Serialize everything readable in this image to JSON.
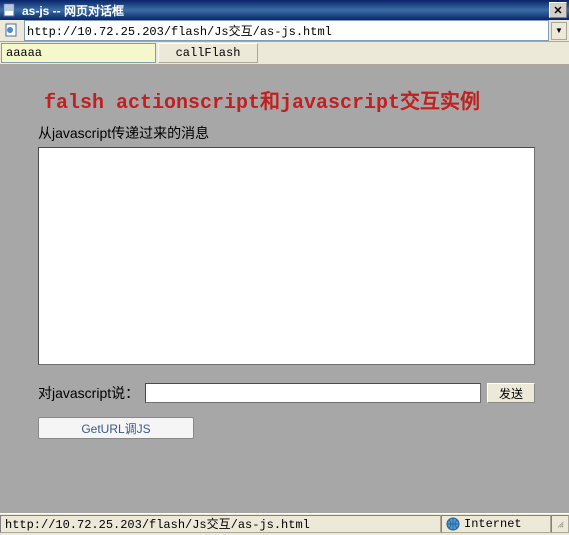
{
  "titlebar": {
    "title": "as-js -- 网页对话框"
  },
  "addressbar": {
    "url": "http://10.72.25.203/flash/Js交互/as-js.html"
  },
  "toolbar": {
    "input_value": "aaaaa",
    "callflash_label": "callFlash"
  },
  "content": {
    "heading": "falsh actionscript和javascript交互实例",
    "subtitle": "从javascript传递过来的消息",
    "send_label": "对javascript说：",
    "send_button": "发送",
    "geturl_button": "GetURL调JS"
  },
  "statusbar": {
    "url": "http://10.72.25.203/flash/Js交互/as-js.html",
    "zone": "Internet"
  }
}
